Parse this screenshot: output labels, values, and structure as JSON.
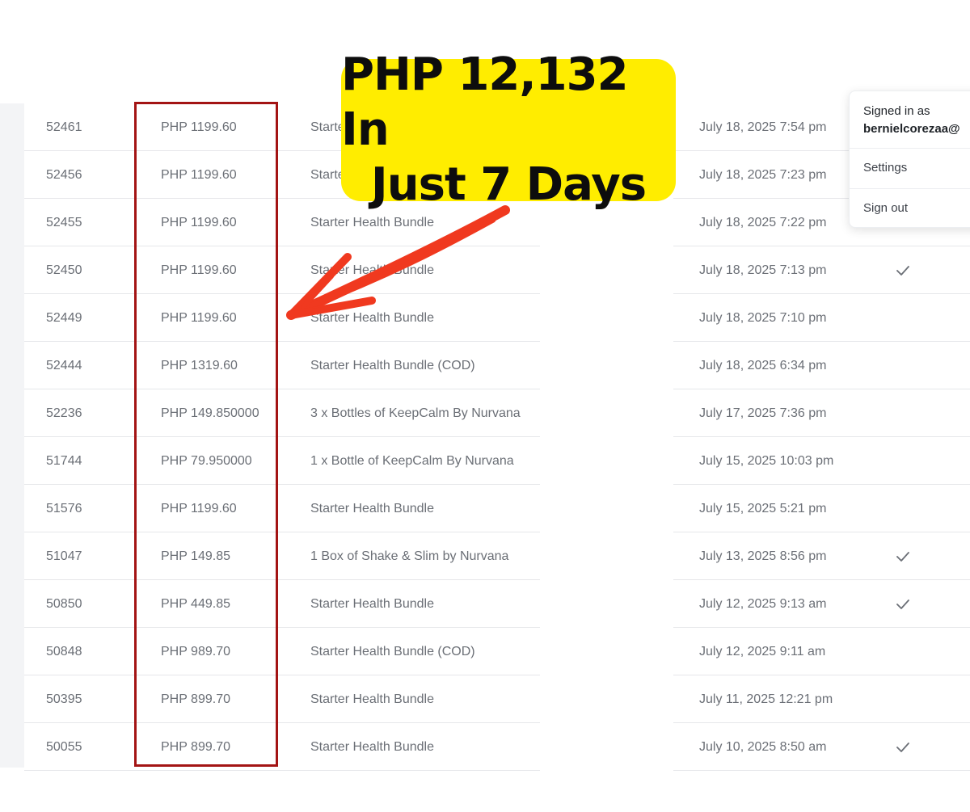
{
  "callout": {
    "line1": "PHP 12,132 In",
    "line2": "Just 7 Days"
  },
  "user_menu": {
    "signed_in_as": "Signed in as",
    "email": "bernielcorezaa@",
    "settings": "Settings",
    "sign_out": "Sign out"
  },
  "orders": [
    {
      "id": "52461",
      "amount": "PHP 1199.60",
      "product": "Starte",
      "date": "July 18, 2025 7:54 pm",
      "checked": false
    },
    {
      "id": "52456",
      "amount": "PHP 1199.60",
      "product": "Starte",
      "date": "July 18, 2025 7:23 pm",
      "checked": false
    },
    {
      "id": "52455",
      "amount": "PHP 1199.60",
      "product": "Starter Health Bundle",
      "date": "July 18, 2025 7:22 pm",
      "checked": false
    },
    {
      "id": "52450",
      "amount": "PHP 1199.60",
      "product": "Starter Health Bundle",
      "date": "July 18, 2025 7:13 pm",
      "checked": true
    },
    {
      "id": "52449",
      "amount": "PHP 1199.60",
      "product": "Starter Health Bundle",
      "date": "July 18, 2025 7:10 pm",
      "checked": false
    },
    {
      "id": "52444",
      "amount": "PHP 1319.60",
      "product": "Starter Health Bundle (COD)",
      "date": "July 18, 2025 6:34 pm",
      "checked": false
    },
    {
      "id": "52236",
      "amount": "PHP 149.850000",
      "product": "3 x Bottles of KeepCalm By Nurvana",
      "date": "July 17, 2025 7:36 pm",
      "checked": false
    },
    {
      "id": "51744",
      "amount": "PHP 79.950000",
      "product": "1 x Bottle of KeepCalm By Nurvana",
      "date": "July 15, 2025 10:03 pm",
      "checked": false
    },
    {
      "id": "51576",
      "amount": "PHP 1199.60",
      "product": "Starter Health Bundle",
      "date": "July 15, 2025 5:21 pm",
      "checked": false
    },
    {
      "id": "51047",
      "amount": "PHP 149.85",
      "product": "1 Box of Shake & Slim by Nurvana",
      "date": "July 13, 2025 8:56 pm",
      "checked": true
    },
    {
      "id": "50850",
      "amount": "PHP 449.85",
      "product": "Starter Health Bundle",
      "date": "July 12, 2025 9:13 am",
      "checked": true
    },
    {
      "id": "50848",
      "amount": "PHP 989.70",
      "product": "Starter Health Bundle (COD)",
      "date": "July 12, 2025 9:11 am",
      "checked": false
    },
    {
      "id": "50395",
      "amount": "PHP 899.70",
      "product": "Starter Health Bundle",
      "date": "July 11, 2025 12:21 pm",
      "checked": false
    },
    {
      "id": "50055",
      "amount": "PHP 899.70",
      "product": "Starter Health Bundle",
      "date": "July 10, 2025 8:50 am",
      "checked": true
    }
  ],
  "colors": {
    "highlight_box": "#a31414",
    "callout_bg": "#ffed00",
    "arrow": "#f0391f"
  },
  "icons": {
    "check": "check-icon",
    "arrow": "red-arrow-icon"
  }
}
